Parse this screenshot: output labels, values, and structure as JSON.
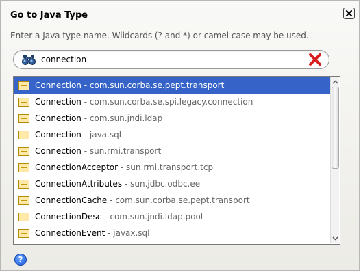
{
  "dialog": {
    "title": "Go to Java Type",
    "subtitle": "Enter a Java type name.  Wildcards (? and *) or camel case may be used."
  },
  "search": {
    "value": "connection",
    "icon": "binoculars-icon",
    "clear_icon": "red-x-clear-icon"
  },
  "results": [
    {
      "name": "Connection",
      "sep": " - ",
      "package": "com.sun.corba.se.pept.transport",
      "selected": true
    },
    {
      "name": "Connection",
      "sep": " - ",
      "package": "com.sun.corba.se.spi.legacy.connection",
      "selected": false
    },
    {
      "name": "Connection",
      "sep": " - ",
      "package": "com.sun.jndi.ldap",
      "selected": false
    },
    {
      "name": "Connection",
      "sep": " - ",
      "package": "java.sql",
      "selected": false
    },
    {
      "name": "Connection",
      "sep": " - ",
      "package": "sun.rmi.transport",
      "selected": false
    },
    {
      "name": "ConnectionAcceptor",
      "sep": " - ",
      "package": "sun.rmi.transport.tcp",
      "selected": false
    },
    {
      "name": "ConnectionAttributes",
      "sep": " - ",
      "package": "sun.jdbc.odbc.ee",
      "selected": false
    },
    {
      "name": "ConnectionCache",
      "sep": " - ",
      "package": "com.sun.corba.se.pept.transport",
      "selected": false
    },
    {
      "name": "ConnectionDesc",
      "sep": " - ",
      "package": "com.sun.jndi.ldap.pool",
      "selected": false
    },
    {
      "name": "ConnectionEvent",
      "sep": " - ",
      "package": "javax.sql",
      "selected": false
    }
  ],
  "help": {
    "glyph": "?"
  },
  "colors": {
    "selection": "#3563c7",
    "package_text": "#666666",
    "clear_x": "#d81e1e"
  }
}
